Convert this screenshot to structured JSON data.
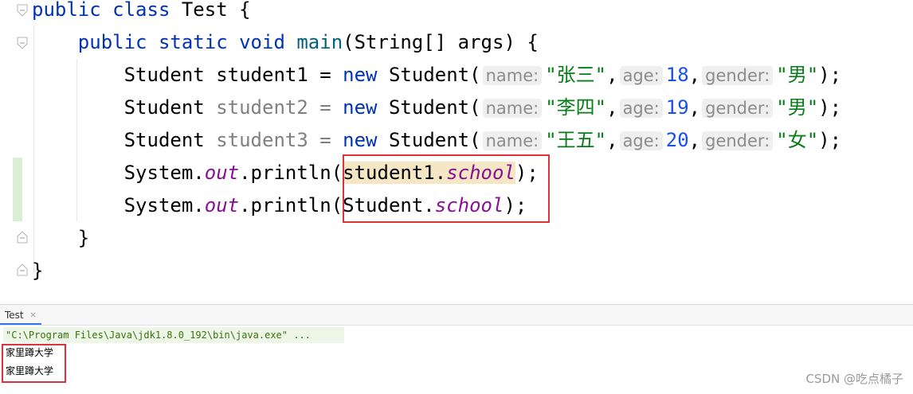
{
  "code": {
    "l1": {
      "kw1": "public",
      "kw2": "class",
      "name": "Test",
      "brace": "{"
    },
    "l2": {
      "kw1": "public",
      "kw2": "static",
      "kw3": "void",
      "method": "main",
      "params": "(String[] args) {"
    },
    "l3": {
      "type": "Student",
      "var": "student1",
      "eq": "=",
      "kw": "new",
      "ctor": "Student(",
      "h_name": "name:",
      "v_name": "\"张三\"",
      "h_age": "age:",
      "v_age": "18",
      "h_gender": "gender:",
      "v_gender": "\"男\"",
      "end": ");"
    },
    "l4": {
      "type": "Student",
      "var": "student2",
      "eq": "=",
      "kw": "new",
      "ctor": "Student(",
      "h_name": "name:",
      "v_name": "\"李四\"",
      "h_age": "age:",
      "v_age": "19",
      "h_gender": "gender:",
      "v_gender": "\"男\"",
      "end": ");"
    },
    "l5": {
      "type": "Student",
      "var": "student3",
      "eq": "=",
      "kw": "new",
      "ctor": "Student(",
      "h_name": "name:",
      "v_name": "\"王五\"",
      "h_age": "age:",
      "v_age": "20",
      "h_gender": "gender:",
      "v_gender": "\"女\"",
      "end": ");"
    },
    "l6": {
      "recv": "System.",
      "field": "out",
      "call": ".println(",
      "arg_obj": "student1.",
      "arg_field": "school",
      "end": ");"
    },
    "l7": {
      "recv": "System.",
      "field": "out",
      "call": ".println(",
      "arg_obj": "Student.",
      "arg_field": "school",
      "end": ");"
    },
    "l8": {
      "brace": "}"
    },
    "l9": {
      "brace": "}"
    }
  },
  "run_panel": {
    "tab_label": "Test",
    "tab_close": "×",
    "command": "\"C:\\Program Files\\Java\\jdk1.8.0_192\\bin\\java.exe\" ...",
    "output": [
      "家里蹲大学",
      "家里蹲大学"
    ]
  },
  "watermark": "CSDN @吃点橘子",
  "colors": {
    "keyword": "#0033b3",
    "string": "#067d17",
    "number": "#1750eb",
    "static_field": "#871094",
    "highlight_box": "#e0303a"
  }
}
